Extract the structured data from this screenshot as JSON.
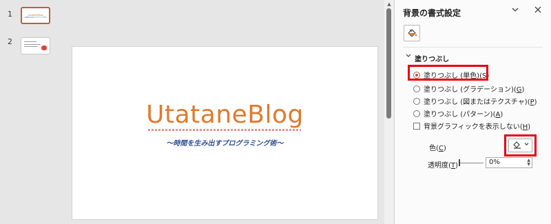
{
  "thumbnails": [
    {
      "number": "1",
      "title": "UtataneBlog",
      "subtitle": "〜時間を生み出すプログラミング術〜",
      "selected": true
    },
    {
      "number": "2",
      "title": "",
      "subtitle": "",
      "selected": false
    }
  ],
  "slide": {
    "title": "UtataneBlog",
    "subtitle": "〜時間を生み出すプログラミング術〜",
    "title_color": "#e07a2e",
    "subtitle_color": "#2f4f8f"
  },
  "pane": {
    "title": "背景の書式設定",
    "collapse_icon": "chevron-down-icon",
    "close_icon": "close-icon",
    "fill_tab_icon": "paint-bucket-icon",
    "section": "塗りつぶし",
    "options": [
      {
        "label": "塗りつぶし (単色)",
        "key": "S",
        "selected": true
      },
      {
        "label": "塗りつぶし (グラデーション)",
        "key": "G",
        "selected": false
      },
      {
        "label": "塗りつぶし (図またはテクスチャ)",
        "key": "P",
        "selected": false
      },
      {
        "label": "塗りつぶし (パターン)",
        "key": "A",
        "selected": false
      }
    ],
    "hide_graphics": {
      "label": "背景グラフィックを表示しない",
      "key": "H",
      "checked": false
    },
    "color": {
      "label": "色",
      "key": "C"
    },
    "transparency": {
      "label": "透明度",
      "key": "T",
      "value": "0%"
    },
    "highlight_color": "#e8000b"
  }
}
